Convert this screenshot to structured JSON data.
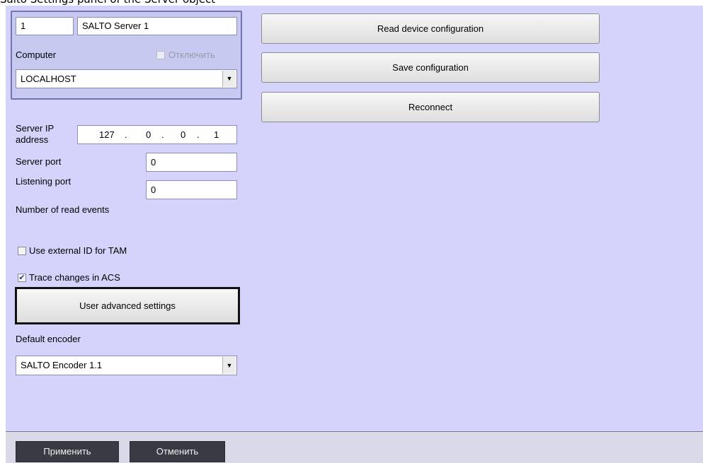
{
  "top_caption": "Salto Settings panel of the Server object",
  "server": {
    "id": "1",
    "name": "SALTO Server 1",
    "computer_label": "Computer",
    "disable_label": "Отключить",
    "computer_value": "LOCALHOST"
  },
  "actions": {
    "read_config": "Read device configuration",
    "save_config": "Save configuration",
    "reconnect": "Reconnect"
  },
  "settings": {
    "ip_label_line1": "Server IP",
    "ip_label_line2": "address",
    "ip_oct1": "127",
    "ip_oct2": "0",
    "ip_oct3": "0",
    "ip_oct4": "1",
    "ip_dot": ".",
    "server_port_label": "Server port",
    "server_port_value": "0",
    "listening_port_label": "Listening port",
    "listening_port_value": "0",
    "read_events_label": "Number of read events",
    "use_external_id_label": "Use external ID for TAM",
    "use_external_id_checked": false,
    "trace_changes_label": "Trace changes in ACS",
    "trace_changes_checked": true,
    "advanced_button": "User advanced settings",
    "encoder_label": "Default encoder",
    "encoder_value": "SALTO Encoder 1.1"
  },
  "footer": {
    "apply": "Применить",
    "cancel": "Отменить"
  },
  "icons": {
    "dropdown_arrow": "chevron-down-icon",
    "check": "check-icon"
  }
}
